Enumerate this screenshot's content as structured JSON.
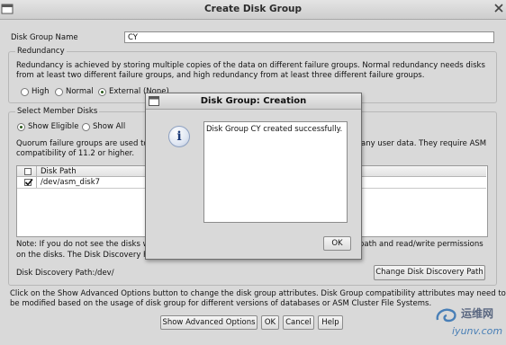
{
  "window": {
    "title": "Create Disk Group"
  },
  "form": {
    "name_label": "Disk Group Name",
    "name_value": "CY"
  },
  "redundancy": {
    "legend": "Redundancy",
    "description_1": "Redundancy is achieved by storing multiple copies of the data on different failure groups. Normal redundancy needs disks",
    "description_2": "from at least two different failure groups, and high redundancy from at least three different failure groups.",
    "options": [
      "High",
      "Normal",
      "External (None)"
    ],
    "selected": "External (None)"
  },
  "members": {
    "legend": "Select Member Disks",
    "filters": [
      "Show Eligible",
      "Show All"
    ],
    "selected_filter": "Show Eligible",
    "quorum_text_1": "Quorum failure groups are used to",
    "quorum_text_1_right": "any user data. They require ASM",
    "quorum_text_2": "compatibility of 11.2 or higher.",
    "table": {
      "column": "Disk Path",
      "rows": [
        {
          "path": "/dev/asm_disk7",
          "checked": true
        }
      ]
    },
    "note_1_left": "Note: If you do not see the disks w",
    "note_1_right": "path and read/write permissions",
    "note_2_left": "on the disks. The Disk Discovery P",
    "discovery_label": "Disk Discovery Path:/dev/",
    "change_button": "Change Disk Discovery Path"
  },
  "advanced_text_1": "Click on the Show Advanced Options button to change the disk group attributes. Disk Group compatibility attributes may need to",
  "advanced_text_2": "be modified based on the usage of disk group for different versions of databases or ASM Cluster File Systems.",
  "buttons": {
    "advanced": "Show Advanced Options",
    "ok": "OK",
    "cancel": "Cancel",
    "help": "Help"
  },
  "dialog": {
    "title": "Disk Group: Creation",
    "icon": "info-icon",
    "icon_glyph": "i",
    "message": "Disk Group CY created successfully.",
    "ok": "OK"
  },
  "watermark": {
    "cn": "运维网",
    "en": "iyunv.com"
  }
}
